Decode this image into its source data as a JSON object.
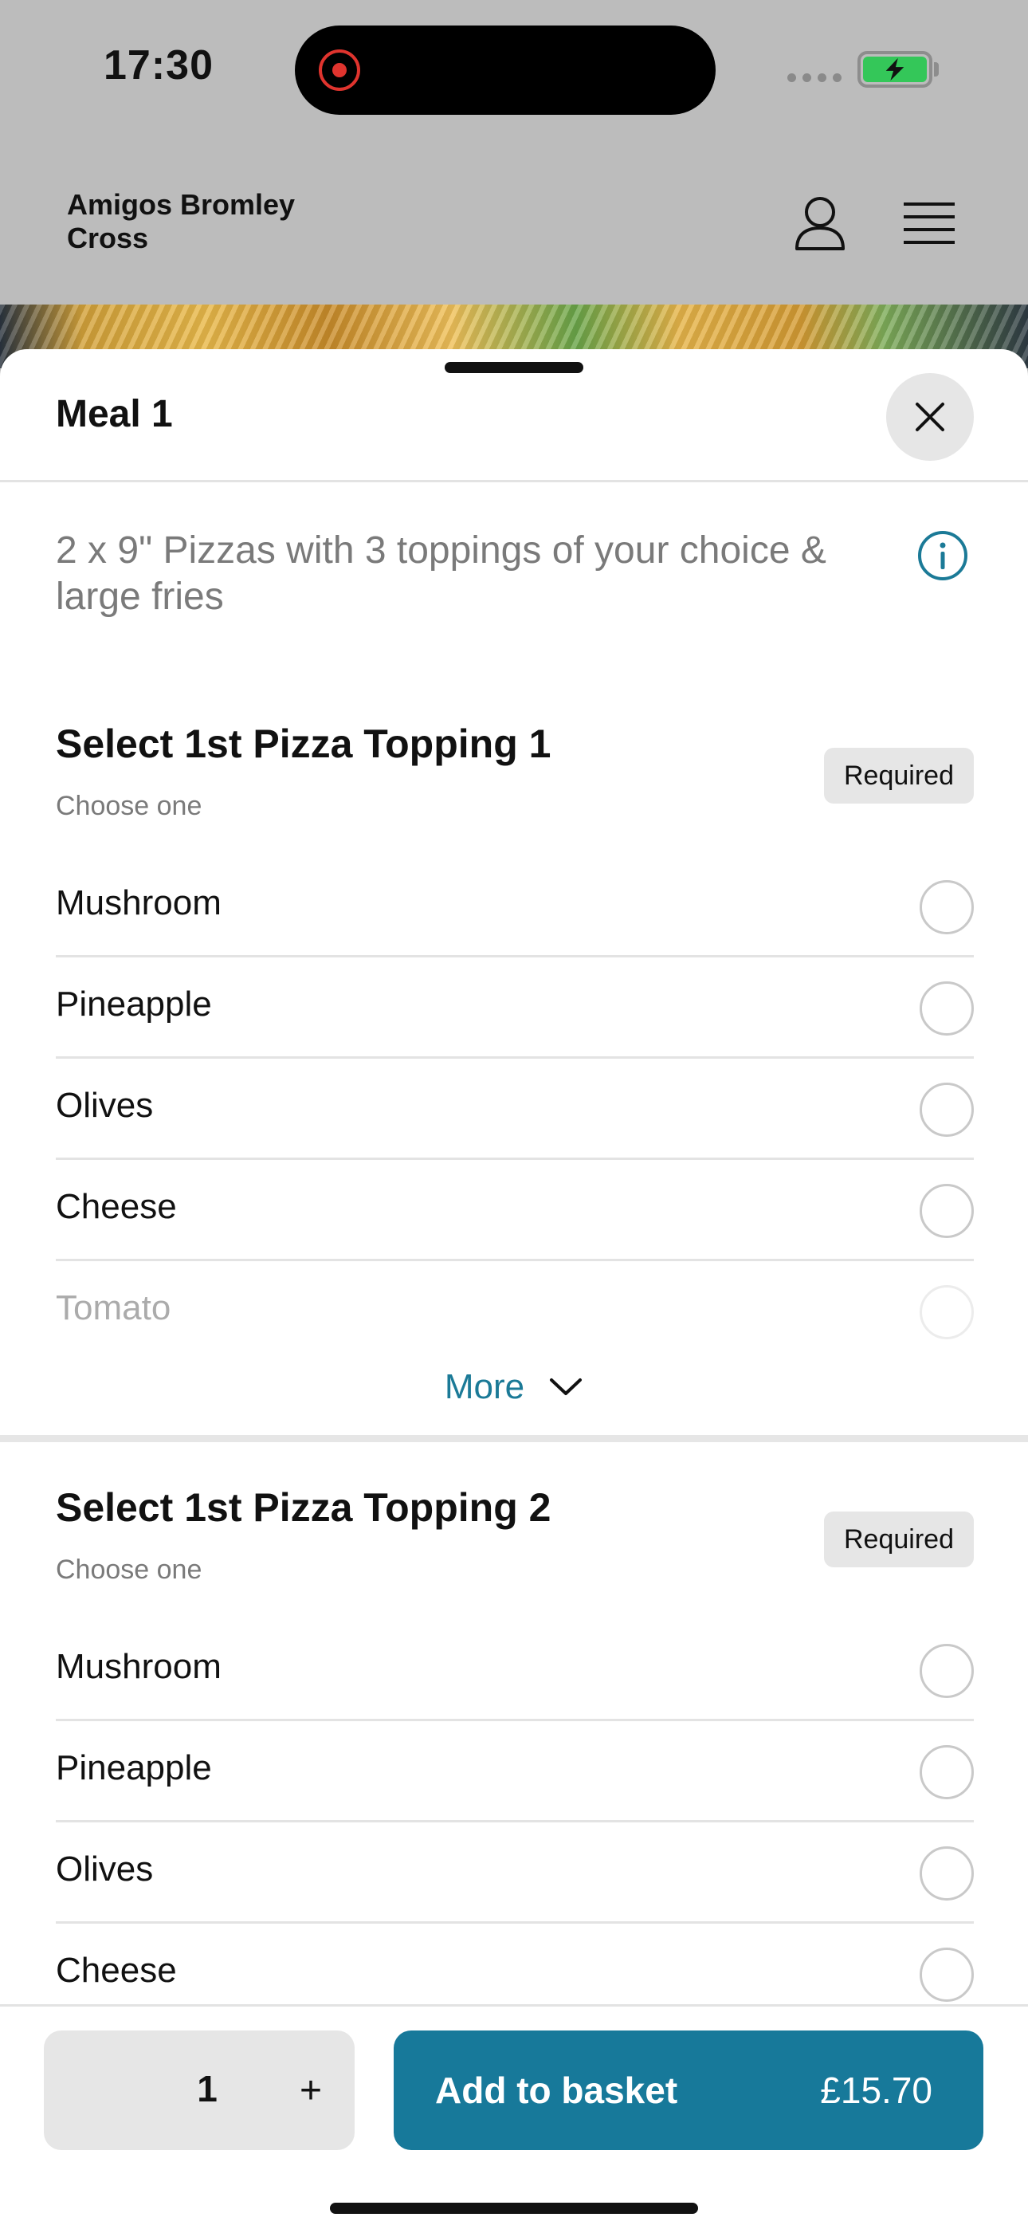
{
  "status_bar": {
    "time": "17:30"
  },
  "header": {
    "store_name": "Amigos Bromley Cross"
  },
  "sheet": {
    "title": "Meal 1",
    "description": "2 x 9\" Pizzas with 3 toppings of your choice & large fries"
  },
  "sections": [
    {
      "title": "Select 1st Pizza Topping 1",
      "subtitle": "Choose one",
      "badge": "Required",
      "options": [
        "Mushroom",
        "Pineapple",
        "Olives",
        "Cheese",
        "Tomato"
      ],
      "more_label": "More"
    },
    {
      "title": "Select 1st Pizza Topping 2",
      "subtitle": "Choose one",
      "badge": "Required",
      "options": [
        "Mushroom",
        "Pineapple",
        "Olives",
        "Cheese"
      ]
    }
  ],
  "footer": {
    "quantity": "1",
    "plus_label": "+",
    "add_label": "Add to basket",
    "price": "£15.70"
  },
  "colors": {
    "accent": "#17799a",
    "badge_bg": "#e6e6e6",
    "battery": "#34c759"
  },
  "icons": [
    "account-icon",
    "menu-icon",
    "close-icon",
    "info-icon",
    "chevron-down-icon"
  ]
}
